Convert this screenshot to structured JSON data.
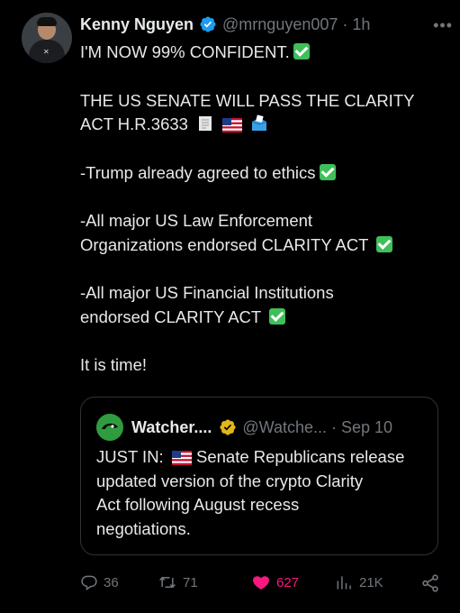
{
  "author": {
    "name": "Kenny Nguyen",
    "handle": "@mrnguyen007",
    "time": "1h"
  },
  "tweet": {
    "lines": [
      "I'M NOW 99% CONFIDENT.",
      "THE US SENATE WILL PASS THE CLARITY",
      "ACT H.R.3633",
      "-Trump already agreed to ethics",
      "-All major US Law Enforcement",
      "Organizations endorsed CLARITY ACT",
      "-All major US Financial Institutions",
      "endorsed CLARITY ACT",
      "It is time!"
    ]
  },
  "quote": {
    "name": "Watcher....",
    "handle": "@Watche...",
    "time": "Sep 10",
    "lines": [
      "JUST IN:",
      "Senate Republicans release",
      "updated version of the crypto Clarity",
      "Act following August recess",
      "negotiations."
    ]
  },
  "stats": {
    "replies": "36",
    "reposts": "71",
    "likes": "627",
    "views": "21K"
  },
  "colors": {
    "background": "#000000",
    "text": "#e7e9ea",
    "muted": "#71767b",
    "verified_blue": "#1d9bf0",
    "verified_gold": "#e2b719",
    "like_pink": "#f91880",
    "check_green": "#3fbf5a"
  },
  "icons": [
    "verified-badge-icon",
    "more-icon",
    "check-mark-icon",
    "receipt-icon",
    "us-flag-icon",
    "ballot-box-icon",
    "reply-icon",
    "repost-icon",
    "like-icon",
    "views-icon",
    "share-icon"
  ]
}
